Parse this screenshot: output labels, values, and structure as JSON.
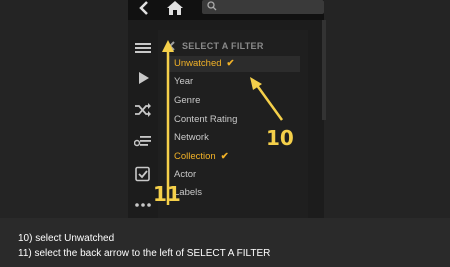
{
  "panel": {
    "header": "SELECT A FILTER",
    "items": [
      {
        "label": "Unwatched",
        "checked": true
      },
      {
        "label": "Year",
        "checked": false
      },
      {
        "label": "Genre",
        "checked": false
      },
      {
        "label": "Content Rating",
        "checked": false
      },
      {
        "label": "Network",
        "checked": false
      },
      {
        "label": "Collection",
        "checked": true
      },
      {
        "label": "Actor",
        "checked": false
      },
      {
        "label": "Labels",
        "checked": false
      }
    ],
    "check_mark": "✔"
  },
  "annotations": {
    "step_10_label": "10",
    "step_11_label": "11",
    "arrow_color": "#f5d04a"
  },
  "icons": {
    "top": [
      "back-arrow-icon",
      "home-icon",
      "search-icon"
    ],
    "rail": [
      "menu-icon",
      "play-icon",
      "shuffle-icon",
      "playlist-add-icon",
      "checklist-icon",
      "more-icon"
    ]
  },
  "caption": {
    "line1": "10) select Unwatched",
    "line2": "11) select the back arrow to the left of SELECT A FILTER"
  },
  "colors": {
    "accent": "#f2b227",
    "background": "#1c1c1c"
  }
}
